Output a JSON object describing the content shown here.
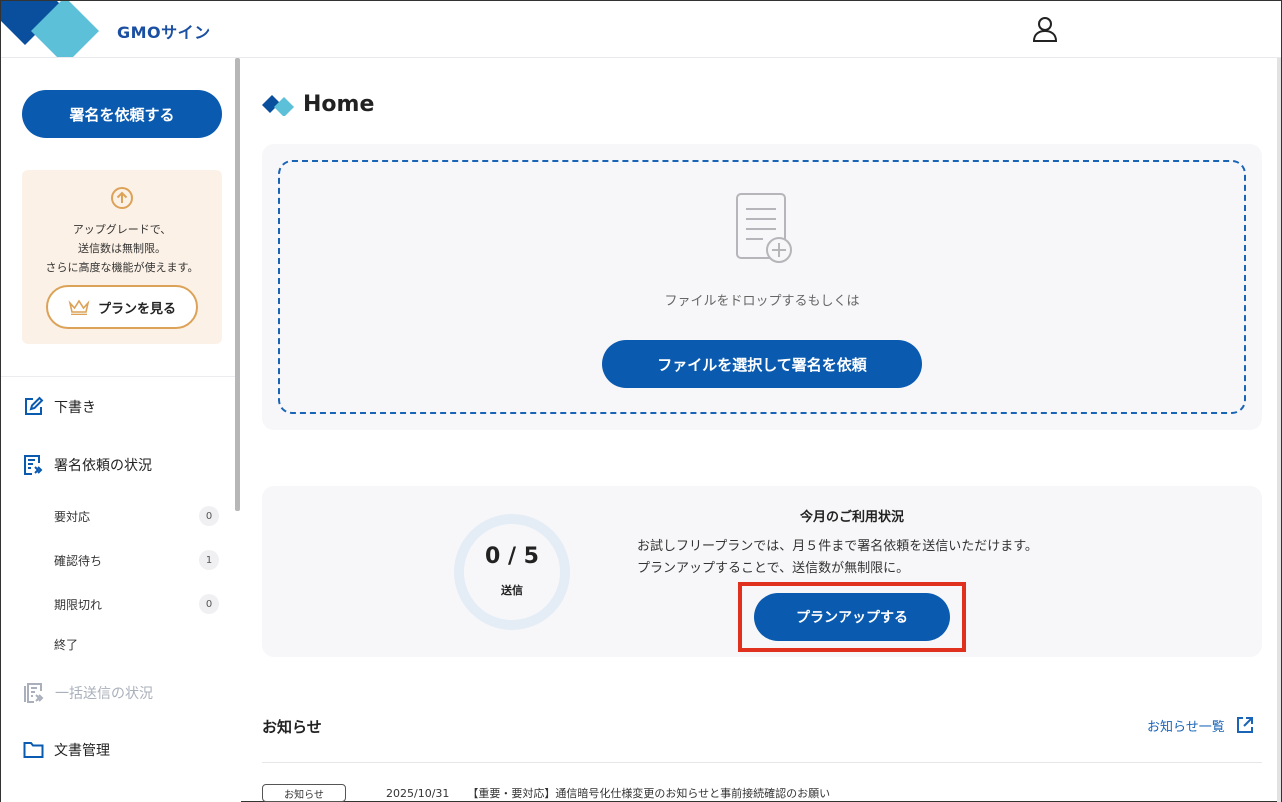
{
  "header": {
    "logo_text": "GMOサイン"
  },
  "sidebar": {
    "request_button": "署名を依頼する",
    "upgrade": {
      "line1": "アップグレードで、",
      "line2": "送信数は無制限。",
      "line3": "さらに高度な機能が使えます。",
      "plan_button": "プランを見る"
    },
    "nav": {
      "draft": "下書き",
      "request_status": "署名依頼の状況",
      "bulk_status": "一括送信の状況",
      "documents": "文書管理"
    },
    "sub_items": [
      {
        "label": "要対応",
        "count": "0"
      },
      {
        "label": "確認待ち",
        "count": "1"
      },
      {
        "label": "期限切れ",
        "count": "0"
      },
      {
        "label": "終了",
        "count": ""
      }
    ]
  },
  "main": {
    "title": "Home",
    "drop": {
      "hint": "ファイルをドロップするもしくは",
      "select_button": "ファイルを選択して署名を依頼"
    },
    "usage": {
      "value": "0 / 5",
      "value_label": "送信",
      "used": 0,
      "limit": 5,
      "title": "今月のご利用状況",
      "desc1": "お試しフリープランでは、月５件まで署名依頼を送信いただけます。",
      "desc2": "プランアップすることで、送信数が無制限に。",
      "planup_button": "プランアップする"
    },
    "news": {
      "title": "お知らせ",
      "list_link": "お知らせ一覧",
      "items": [
        {
          "tag": "お知らせ",
          "date": "2025/10/31",
          "text": "【重要・要対応】通信暗号化仕様変更のお知らせと事前接続確認のお願い"
        }
      ]
    }
  },
  "colors": {
    "primary": "#0a5ab0",
    "accent_orange": "#dca257",
    "highlight_red": "#e0301e",
    "upgrade_bg": "#fcf1e6"
  }
}
